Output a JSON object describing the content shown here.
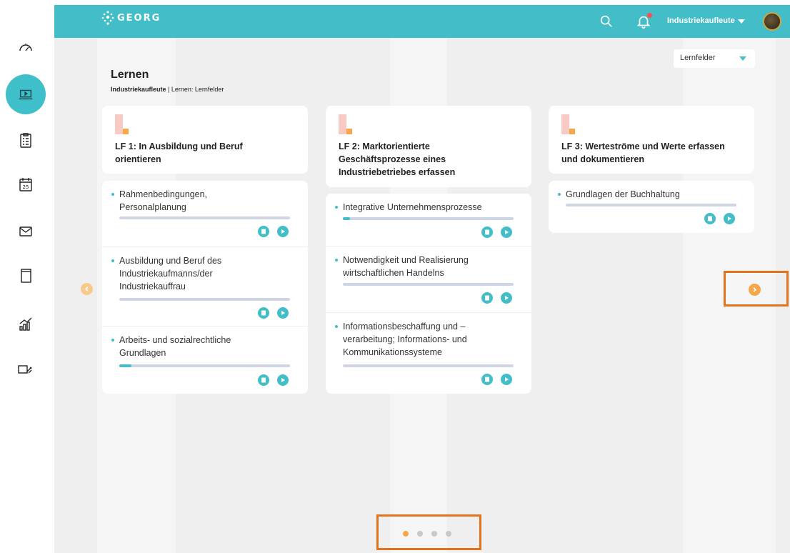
{
  "app": {
    "logo_text": "GEORG"
  },
  "header": {
    "user_name": "Industriekaufleute"
  },
  "filter": {
    "selected": "Lernfelder"
  },
  "page": {
    "title": "Lernen",
    "breadcrumb_bold": "Industriekaufleute",
    "breadcrumb_rest": " | Lernen: Lernfelder"
  },
  "sidebar": {
    "items": [
      {
        "icon": "dashboard-gauge-icon"
      },
      {
        "icon": "learning-laptop-icon",
        "active": true
      },
      {
        "icon": "checklist-clipboard-icon"
      },
      {
        "icon": "calendar-icon",
        "text": "25"
      },
      {
        "icon": "mail-icon"
      },
      {
        "icon": "book-icon"
      },
      {
        "icon": "statistics-chart-icon"
      },
      {
        "icon": "tools-icon"
      }
    ]
  },
  "cards": [
    {
      "title_lines": [
        "LF 1: In Ausbildung und Beruf",
        "orientieren"
      ],
      "topics": [
        {
          "lines": [
            "Rahmenbedingungen,",
            "Personalplanung"
          ],
          "progress": 0.0
        },
        {
          "lines": [
            "Ausbildung und Beruf des",
            "Industriekaufmanns/der",
            "Industriekauffrau"
          ],
          "progress": 0.0
        },
        {
          "lines": [
            "Arbeits- und sozialrechtliche",
            "Grundlagen"
          ],
          "progress": 0.07
        }
      ]
    },
    {
      "title_lines": [
        "LF 2: Marktorientierte",
        "Geschäftsprozesse eines",
        "Industriebetriebes erfassen"
      ],
      "topics": [
        {
          "lines": [
            "Integrative Unternehmensprozesse"
          ],
          "progress": 0.04
        },
        {
          "lines": [
            "Notwendigkeit und Realisierung",
            "wirtschaftlichen Handelns"
          ],
          "progress": 0.0
        },
        {
          "lines": [
            "Informationsbeschaffung und –",
            "verarbeitung; Informations- und",
            "Kommunikationssysteme"
          ],
          "progress": 0.0
        }
      ]
    },
    {
      "title_lines": [
        "LF 3: Werteströme und Werte erfassen",
        "und dokumentieren"
      ],
      "topics": [
        {
          "lines": [
            "Grundlagen der Buchhaltung"
          ],
          "progress": 0.0
        }
      ]
    }
  ],
  "pagination": {
    "count": 4,
    "active": 0
  },
  "colors": {
    "accent": "#43bec8",
    "orange": "#f5a84a",
    "highlight": "#e0731d"
  }
}
